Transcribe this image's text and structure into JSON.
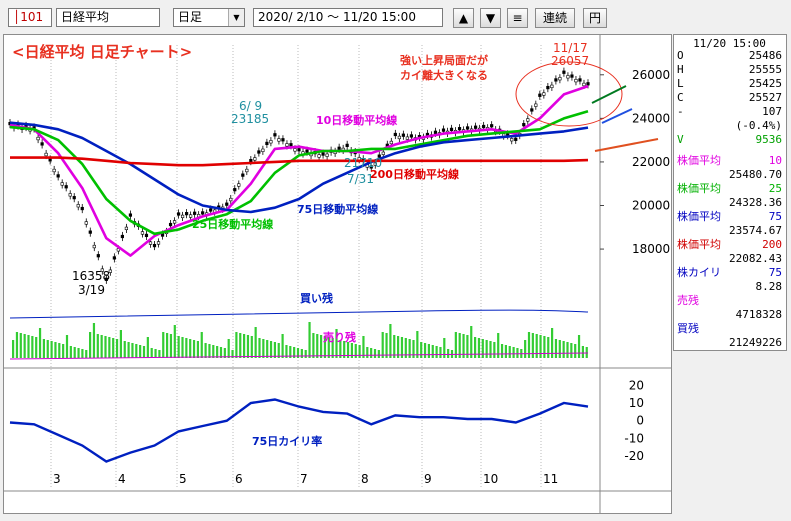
{
  "toolbar": {
    "code": "101",
    "name": "日経平均",
    "period": "日足",
    "range": "2020/ 2/10 〜 11/20 15:00",
    "up_icon": "▲",
    "down_icon": "▼",
    "menu_icon": "≡",
    "continuous_label": "連続",
    "yen_label": "円"
  },
  "side": {
    "datetime": "11/20 15:00",
    "ohlc": [
      {
        "label": "O",
        "value": "25486"
      },
      {
        "label": "H",
        "value": "25555"
      },
      {
        "label": "L",
        "value": "25425"
      },
      {
        "label": "C",
        "value": "25527"
      },
      {
        "label": "-",
        "value": "107"
      }
    ],
    "change_pct": "(-0.4%)",
    "volume_label": "V",
    "volume": "9536",
    "indicators": [
      {
        "label": "株価平均",
        "period": "10",
        "value": "25480.70",
        "color": "#e000e0"
      },
      {
        "label": "株価平均",
        "period": "25",
        "value": "24328.36",
        "color": "#00b000"
      },
      {
        "label": "株価平均",
        "period": "75",
        "value": "23574.67",
        "color": "#0000c0"
      },
      {
        "label": "株価平均",
        "period": "200",
        "value": "22082.43",
        "color": "#d00000"
      }
    ],
    "kairi_label": "株カイリ",
    "kairi_period": "75",
    "kairi_value": "8.28",
    "sell_label": "売残",
    "sell_value": "4718328",
    "buy_label": "買残",
    "buy_value": "21249226"
  },
  "chart_data": {
    "type": "line",
    "title": "<日経平均 日足チャート>",
    "x_ticks": [
      "3",
      "4",
      "5",
      "6",
      "7",
      "8",
      "9",
      "10",
      "11"
    ],
    "price_axis": {
      "ylim": [
        15800,
        27000
      ],
      "ticks": [
        18000,
        20000,
        22000,
        24000,
        26000
      ]
    },
    "kairi_axis": {
      "ylim": [
        -25,
        23
      ],
      "ticks": [
        20,
        10,
        0,
        -10,
        -20
      ]
    },
    "candles_close_approx": [
      {
        "date": "2/10",
        "close": 23700
      },
      {
        "date": "2/20",
        "close": 23500
      },
      {
        "date": "3/2",
        "close": 21300
      },
      {
        "date": "3/10",
        "close": 19800
      },
      {
        "date": "3/19",
        "close": 16552
      },
      {
        "date": "3/25",
        "close": 19500
      },
      {
        "date": "4/1",
        "close": 18100
      },
      {
        "date": "4/15",
        "close": 19550
      },
      {
        "date": "5/1",
        "close": 19600
      },
      {
        "date": "5/15",
        "close": 20000
      },
      {
        "date": "6/1",
        "close": 22000
      },
      {
        "date": "6/9",
        "close": 23185
      },
      {
        "date": "6/20",
        "close": 22500
      },
      {
        "date": "7/1",
        "close": 22300
      },
      {
        "date": "7/20",
        "close": 22700
      },
      {
        "date": "7/31",
        "close": 21710
      },
      {
        "date": "8/15",
        "close": 23200
      },
      {
        "date": "9/1",
        "close": 23100
      },
      {
        "date": "9/15",
        "close": 23400
      },
      {
        "date": "10/1",
        "close": 23500
      },
      {
        "date": "10/15",
        "close": 23600
      },
      {
        "date": "11/1",
        "close": 22977
      },
      {
        "date": "11/10",
        "close": 25000
      },
      {
        "date": "11/17",
        "close": 26057
      },
      {
        "date": "11/20",
        "close": 25527
      }
    ],
    "series": [
      {
        "name": "10日移動平均線",
        "color": "#e000e0",
        "values": [
          23700,
          23500,
          22400,
          20800,
          18500,
          17700,
          18600,
          19100,
          19500,
          19800,
          21000,
          22600,
          22700,
          22500,
          22500,
          22400,
          22800,
          23100,
          23300,
          23400,
          23500,
          23300,
          24000,
          25100,
          25480
        ]
      },
      {
        "name": "25日移動平均線",
        "color": "#00c000",
        "values": [
          23600,
          23500,
          23000,
          21900,
          20300,
          19300,
          18700,
          18900,
          19300,
          19600,
          20200,
          21500,
          22300,
          22500,
          22500,
          22600,
          22600,
          22800,
          23000,
          23200,
          23300,
          23400,
          23500,
          24000,
          24328
        ]
      },
      {
        "name": "75日移動平均線",
        "color": "#0020c0",
        "values": [
          23800,
          23700,
          23500,
          23100,
          22500,
          21900,
          21200,
          20500,
          20000,
          19800,
          19700,
          19900,
          20300,
          21000,
          21500,
          22000,
          22400,
          22700,
          22900,
          23000,
          23100,
          23200,
          23300,
          23400,
          23575
        ]
      },
      {
        "name": "200日移動平均線",
        "color": "#e00000",
        "values": [
          22200,
          22200,
          22200,
          22150,
          22050,
          21950,
          21900,
          21850,
          21850,
          21900,
          21950,
          22000,
          22050,
          22050,
          22050,
          22050,
          22050,
          22050,
          22050,
          22050,
          22050,
          22050,
          22050,
          22050,
          22082
        ]
      },
      {
        "name": "75日カイリ率",
        "color": "#0020c0",
        "values": [
          -1,
          -2,
          -8,
          -14,
          -23,
          -18,
          -14,
          -6,
          -3,
          0,
          10,
          12,
          8,
          5,
          4,
          -2,
          3,
          2,
          2,
          1,
          1,
          -1,
          4,
          10,
          8
        ]
      }
    ],
    "annotations": {
      "high_mark": "6/ 9",
      "high_value": "23185",
      "low_value": "16358",
      "low_date": "3/19",
      "recent_date": "11/17",
      "recent_value": "26057",
      "dip_value": "21710",
      "dip_date": "7/31",
      "comment_line1": "強い上昇局面だが",
      "comment_line2": "カイ離大きくなる",
      "label_10": "10日移動平均線",
      "label_25": "25日移動平均線",
      "label_75": "75日移動平均線",
      "label_200": "200日移動平均線",
      "label_kairi": "75日カイリ率",
      "label_buy": "買い残",
      "label_sell": "売り残"
    },
    "colors": {
      "ma10": "#e000e0",
      "ma25": "#00c000",
      "ma75": "#0020c0",
      "ma200": "#e00000",
      "annotation_red": "#e83020",
      "volume": "#33cc33",
      "high_label": "#2090a0"
    }
  }
}
